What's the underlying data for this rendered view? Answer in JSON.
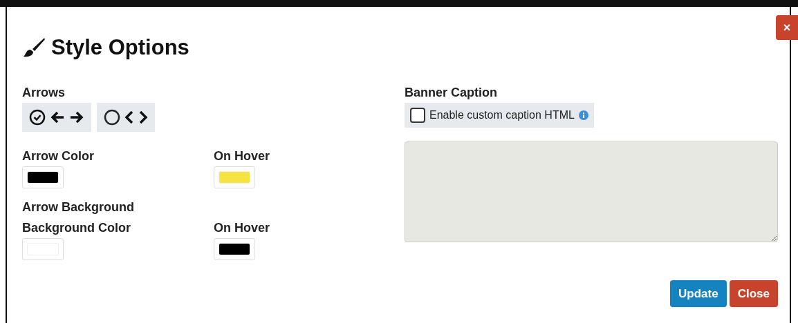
{
  "dialog": {
    "title": "Style Options",
    "close_symbol": "×"
  },
  "arrows": {
    "label": "Arrows",
    "styles": [
      {
        "kind": "arrow",
        "selected": true
      },
      {
        "kind": "chevron",
        "selected": false
      }
    ]
  },
  "arrow_color": {
    "label": "Arrow Color",
    "color": "#000000",
    "hover": {
      "label": "On Hover",
      "color": "#f5e342"
    }
  },
  "arrow_background": {
    "heading": "Arrow Background",
    "label": "Background Color",
    "color": "#ffffff",
    "hover": {
      "label": "On Hover",
      "color": "#000000"
    }
  },
  "banner_caption": {
    "label": "Banner Caption",
    "checkbox_label": "Enable custom caption HTML",
    "checked": false
  },
  "buttons": [
    {
      "label": "Update",
      "kind": "primary"
    },
    {
      "label": "Close",
      "kind": "danger"
    }
  ]
}
